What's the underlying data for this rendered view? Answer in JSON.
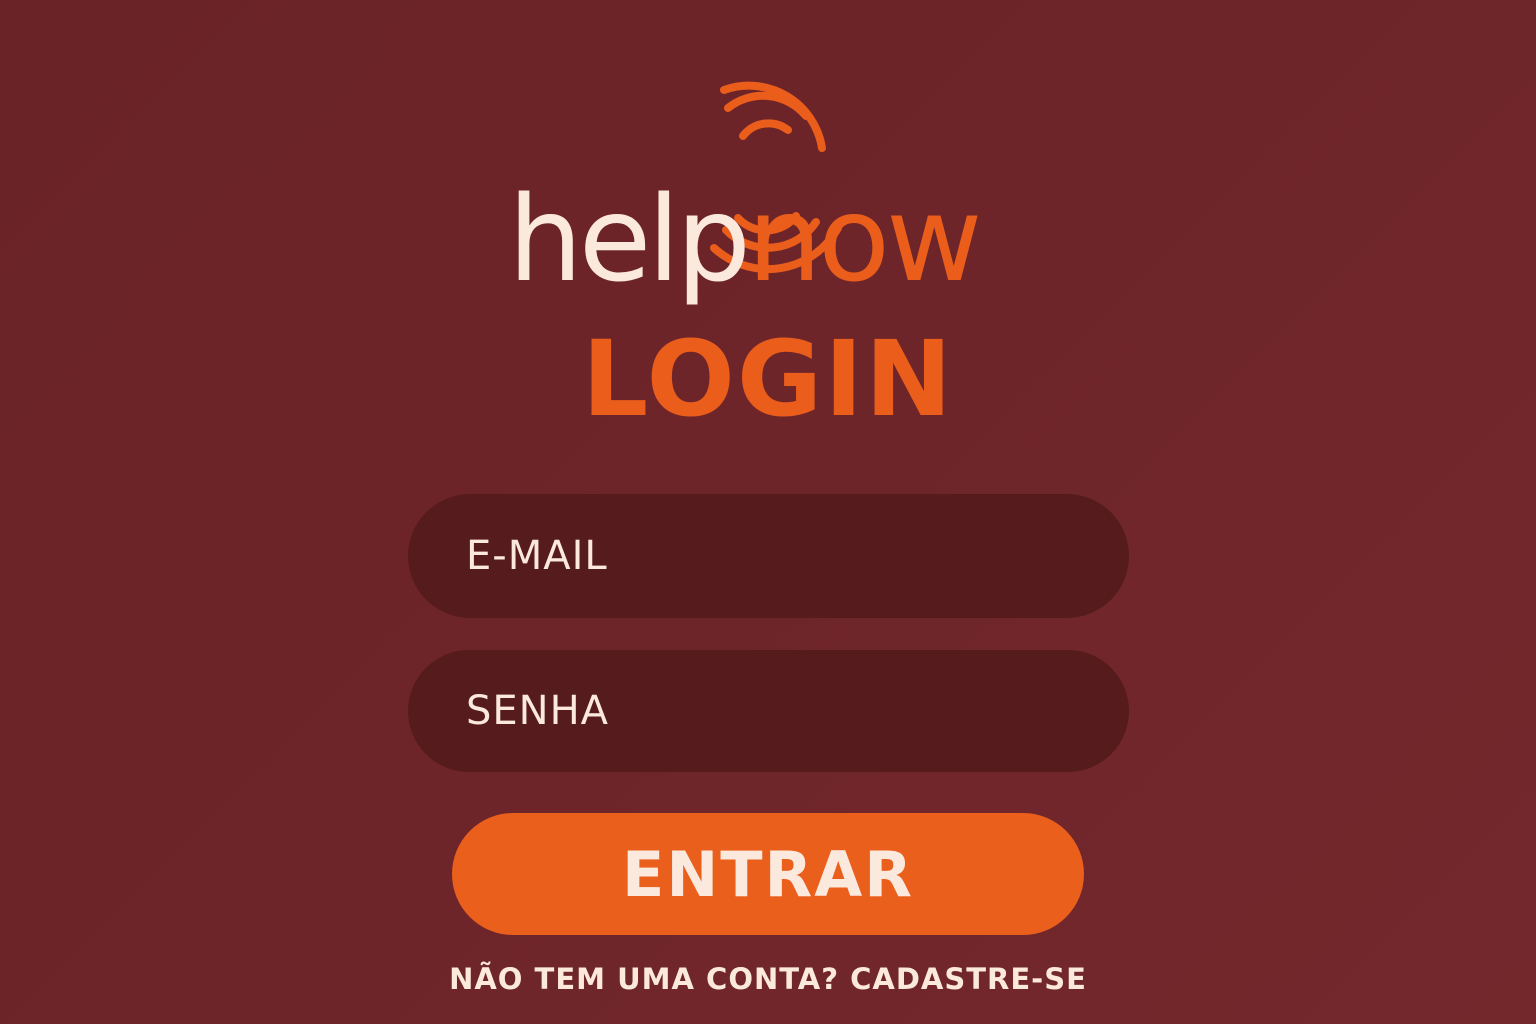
{
  "brand": {
    "logo_part1": "help",
    "logo_part2": "now",
    "icon": "signal-waves-icon"
  },
  "login": {
    "title": "LOGIN",
    "email_placeholder": "E-MAIL",
    "password_placeholder": "SENHA",
    "submit_label": "ENTRAR",
    "signup_text": "NÃO TEM UMA CONTA? CADASTRE-SE"
  },
  "colors": {
    "background": "#6e2529",
    "accent": "#ea5d1b",
    "field_background": "#561b1d",
    "text_light": "#fbe9de"
  }
}
